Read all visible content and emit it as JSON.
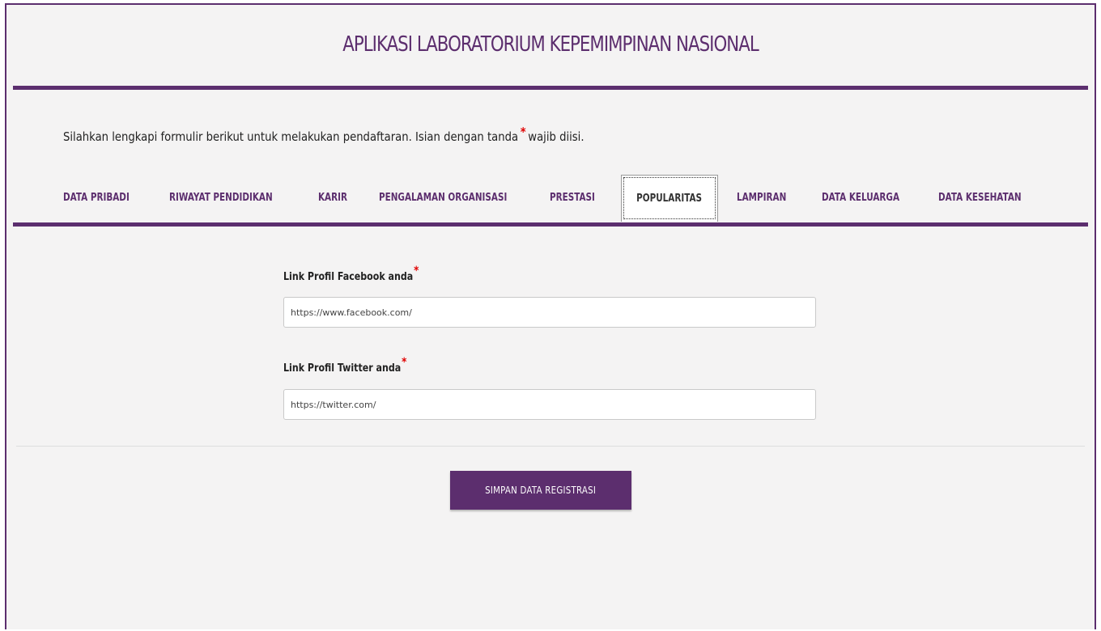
{
  "header": {
    "title": "APLIKASI LABORATORIUM KEPEMIMPINAN NASIONAL"
  },
  "intro": {
    "text_before": "Silahkan lengkapi formulir berikut untuk melakukan pendaftaran. Isian dengan tanda",
    "required_mark": "*",
    "text_after": "wajib diisi."
  },
  "tabs": [
    {
      "label": "DATA PRIBADI",
      "active": false
    },
    {
      "label": "RIWAYAT PENDIDIKAN",
      "active": false
    },
    {
      "label": "KARIR",
      "active": false
    },
    {
      "label": "PENGALAMAN ORGANISASI",
      "active": false
    },
    {
      "label": "PRESTASI",
      "active": false
    },
    {
      "label": "POPULARITAS",
      "active": true
    },
    {
      "label": "LAMPIRAN",
      "active": false
    },
    {
      "label": "DATA KELUARGA",
      "active": false
    },
    {
      "label": "DATA KESEHATAN",
      "active": false
    }
  ],
  "form": {
    "facebook": {
      "label": "Link Profil Facebook anda",
      "required_mark": "*",
      "value": "https://www.facebook.com/"
    },
    "twitter": {
      "label": "Link Profil Twitter anda",
      "required_mark": "*",
      "value": "https://twitter.com/"
    }
  },
  "actions": {
    "save_label": "SIMPAN DATA REGISTRASI"
  },
  "colors": {
    "brand": "#5c2e6e",
    "required": "#e00000",
    "background": "#f4f3f3"
  }
}
